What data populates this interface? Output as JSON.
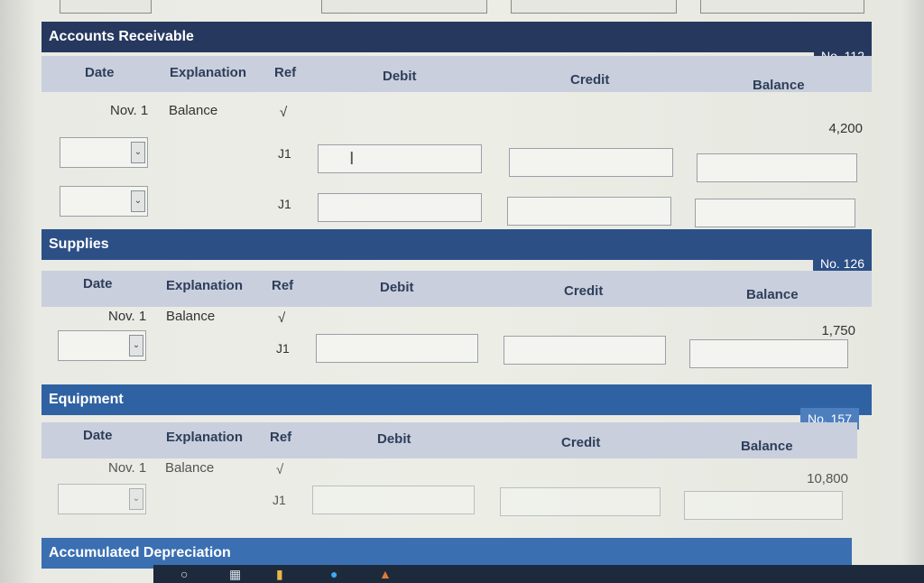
{
  "headers": {
    "date": "Date",
    "explanation": "Explanation",
    "ref": "Ref",
    "debit": "Debit",
    "credit": "Credit",
    "balance": "Balance"
  },
  "accounts": [
    {
      "title": "Accounts Receivable",
      "number": "No. 112",
      "opening": {
        "date": "Nov. 1",
        "explanation": "Balance",
        "ref": "√",
        "balance": "4,200"
      },
      "entries": [
        {
          "ref": "J1"
        },
        {
          "ref": "J1"
        }
      ]
    },
    {
      "title": "Supplies",
      "number": "No. 126",
      "opening": {
        "date": "Nov. 1",
        "explanation": "Balance",
        "ref": "√",
        "balance": "1,750"
      },
      "entries": [
        {
          "ref": "J1"
        }
      ]
    },
    {
      "title": "Equipment",
      "number": "No. 157",
      "opening": {
        "date": "Nov. 1",
        "explanation": "Balance",
        "ref": "√",
        "balance": "10,800"
      },
      "entries": [
        {
          "ref": "J1"
        }
      ]
    },
    {
      "title": "Accumulated Depreciation"
    }
  ],
  "colors": {
    "title_bar": "#26385e",
    "title_bar_light": "#2f62a3",
    "header_bg": "#c9cfdd"
  }
}
